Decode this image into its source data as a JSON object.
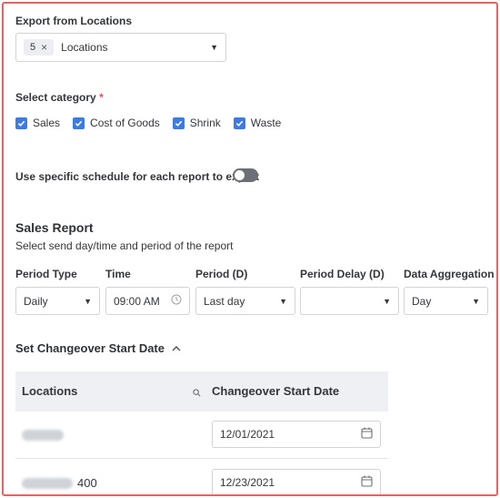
{
  "export": {
    "label": "Export from Locations",
    "chip_count": "5",
    "chip_remove": "×",
    "selected": "Locations"
  },
  "category": {
    "label": "Select category",
    "required_mark": "*",
    "options": [
      "Sales",
      "Cost of Goods",
      "Shrink",
      "Waste"
    ]
  },
  "schedule": {
    "label": "Use specific schedule for each report to export",
    "enabled": false
  },
  "sales_report": {
    "title": "Sales Report",
    "subtitle": "Select send day/time and period of the report",
    "fields": {
      "period_type": {
        "label": "Period Type",
        "value": "Daily"
      },
      "time": {
        "label": "Time",
        "value": "09:00 AM"
      },
      "period": {
        "label": "Period (D)",
        "value": "Last day"
      },
      "period_delay": {
        "label": "Period Delay (D)",
        "value": ""
      },
      "aggregation": {
        "label": "Data Aggregation",
        "value": "Day"
      }
    }
  },
  "changeover": {
    "title": "Set Changeover Start Date",
    "columns": {
      "locations": "Locations",
      "start_date": "Changeover Start Date"
    },
    "rows": [
      {
        "location_suffix": "",
        "date": "12/01/2021"
      },
      {
        "location_suffix": "400",
        "date": "12/23/2021"
      }
    ]
  }
}
